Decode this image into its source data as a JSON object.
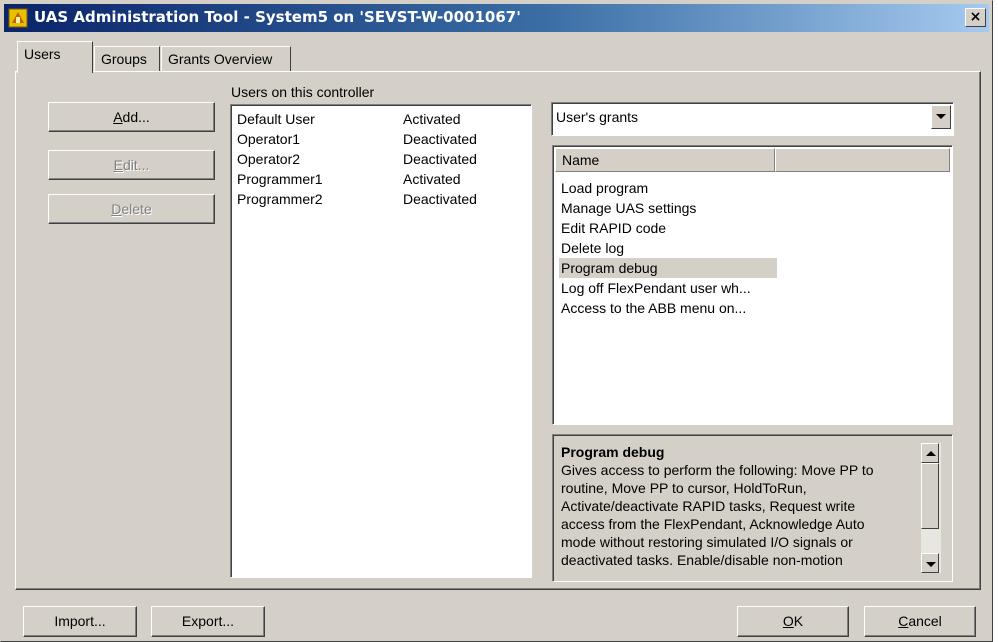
{
  "window": {
    "title": "UAS Administration Tool - System5 on 'SEVST-W-0001067'",
    "close_label": "×"
  },
  "tabs": [
    {
      "label": "Users",
      "active": true
    },
    {
      "label": "Groups",
      "active": false
    },
    {
      "label": "Grants Overview",
      "active": false
    }
  ],
  "users_panel": {
    "list_label": "Users on this controller",
    "add_button": {
      "prefix": "",
      "mnemonic": "A",
      "suffix": "dd..."
    },
    "edit_button": {
      "prefix": "",
      "mnemonic": "E",
      "suffix": "dit..."
    },
    "delete_button": {
      "prefix": "",
      "mnemonic": "D",
      "suffix": "elete"
    },
    "users": [
      {
        "name": "Default User",
        "status": "Activated"
      },
      {
        "name": "Operator1",
        "status": "Deactivated"
      },
      {
        "name": "Operator2",
        "status": "Deactivated"
      },
      {
        "name": "Programmer1",
        "status": "Activated"
      },
      {
        "name": "Programmer2",
        "status": "Deactivated"
      }
    ]
  },
  "grants_panel": {
    "dropdown_value": "User's grants",
    "column_header": "Name",
    "grants": [
      {
        "name": "Load program",
        "selected": false
      },
      {
        "name": "Manage UAS settings",
        "selected": false
      },
      {
        "name": "Edit RAPID code",
        "selected": false
      },
      {
        "name": "Delete log",
        "selected": false
      },
      {
        "name": "Program debug",
        "selected": true
      },
      {
        "name": "Log off FlexPendant user wh...",
        "selected": false
      },
      {
        "name": "Access to the ABB menu on...",
        "selected": false
      }
    ],
    "description": {
      "title": "Program debug",
      "lines": [
        "Gives access to perform the following: Move PP to",
        "routine, Move PP to cursor, HoldToRun,",
        "Activate/deactivate RAPID tasks, Request write",
        "access from the FlexPendant, Acknowledge Auto",
        "mode without restoring simulated I/O signals or",
        "deactivated tasks. Enable/disable non-motion"
      ]
    }
  },
  "footer": {
    "import_label": "Import...",
    "export_label": "Export...",
    "ok_button": {
      "prefix": "",
      "mnemonic": "O",
      "suffix": "K"
    },
    "cancel_button": {
      "prefix": "",
      "mnemonic": "C",
      "suffix": "ancel"
    }
  },
  "colors": {
    "face": "#d4d0c8",
    "title_start": "#0a246a",
    "title_end": "#a6caf0",
    "disabled_text": "#808080"
  }
}
